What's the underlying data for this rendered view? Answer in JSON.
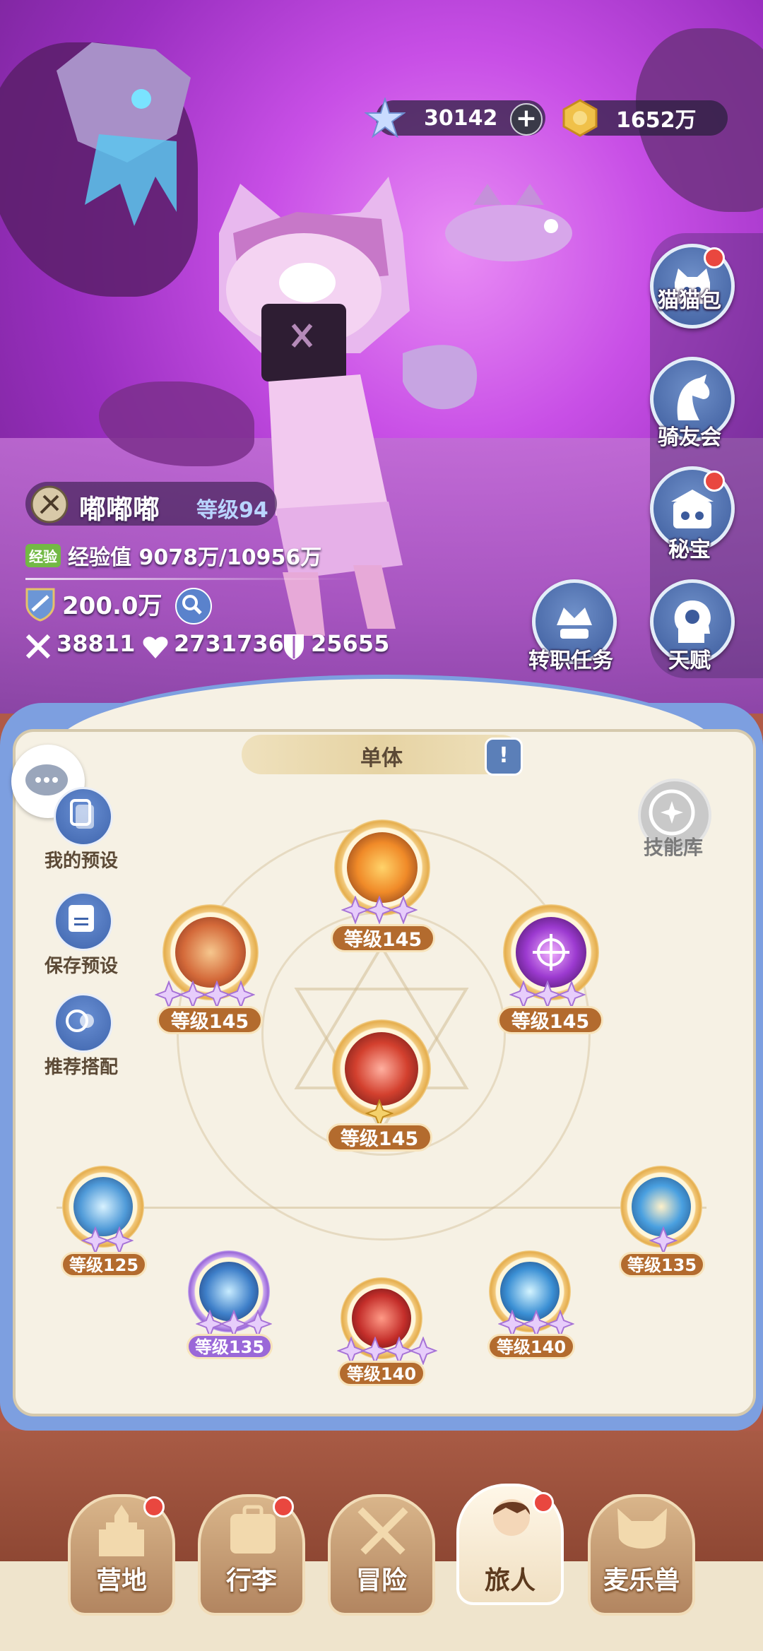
{
  "currency": {
    "crystal": "30142",
    "gold": "1652万"
  },
  "side_menu": [
    {
      "label": "猫猫包",
      "icon": "cat-bag-icon",
      "badge": true
    },
    {
      "label": "骑友会",
      "icon": "horse-icon",
      "badge": false
    },
    {
      "label": "秘宝",
      "icon": "treasure-icon",
      "badge": true
    },
    {
      "label": "天赋",
      "icon": "talent-head-icon",
      "badge": false
    },
    {
      "label": "转职任务",
      "icon": "job-quest-icon",
      "badge": false
    }
  ],
  "player": {
    "name": "嘟嘟嘟",
    "level": "等级94",
    "exp_tag": "经验",
    "exp_text": "经验值 9078万/10956万",
    "power": "200.0万",
    "attack": "38811",
    "hp": "2731736",
    "defense": "25655"
  },
  "panel": {
    "mode": "单体",
    "left_buttons": [
      "我的预设",
      "保存预设",
      "推荐搭配"
    ],
    "skill_library": "技能库"
  },
  "skills": {
    "top": {
      "level": "等级145",
      "stars": 3
    },
    "left": {
      "level": "等级145",
      "stars": 4
    },
    "right": {
      "level": "等级145",
      "stars": 3
    },
    "center": {
      "level": "等级145",
      "stars": 1
    },
    "passive1": {
      "level": "等级125",
      "stars": 2
    },
    "passive2": {
      "level": "等级135",
      "stars": 3
    },
    "passive3": {
      "level": "等级140",
      "stars": 4
    },
    "passive4": {
      "level": "等级140",
      "stars": 3
    },
    "passive5": {
      "level": "等级135",
      "stars": 1
    }
  },
  "nav": [
    {
      "label": "营地",
      "badge": true
    },
    {
      "label": "行李",
      "badge": true
    },
    {
      "label": "冒险",
      "badge": false
    },
    {
      "label": "旅人",
      "badge": true,
      "active": true
    },
    {
      "label": "麦乐兽",
      "badge": false
    }
  ]
}
